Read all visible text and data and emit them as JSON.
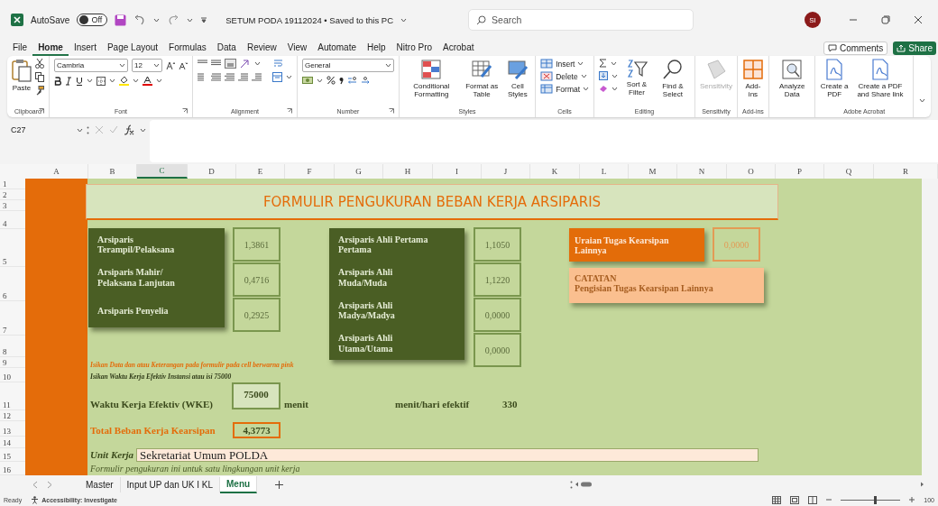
{
  "title_bar": {
    "autosave_label": "AutoSave",
    "autosave": {
      "label": "Off",
      "on": false
    },
    "document_title": "SETUM PODA 19112024 • Saved to this PC",
    "search": {
      "placeholder": "Search"
    },
    "avatar": "SI"
  },
  "menu_tabs": [
    {
      "label": "File",
      "selected": false
    },
    {
      "label": "Home",
      "selected": true
    },
    {
      "label": "Insert",
      "selected": false
    },
    {
      "label": "Page Layout",
      "selected": false
    },
    {
      "label": "Formulas",
      "selected": false
    },
    {
      "label": "Data",
      "selected": false
    },
    {
      "label": "Review",
      "selected": false
    },
    {
      "label": "View",
      "selected": false
    },
    {
      "label": "Automate",
      "selected": false
    },
    {
      "label": "Help",
      "selected": false
    },
    {
      "label": "Nitro Pro",
      "selected": false
    },
    {
      "label": "Acrobat",
      "selected": false
    }
  ],
  "actions": {
    "comments": "Comments",
    "share": "Share"
  },
  "ribbon": [
    {
      "kind": "clipboard",
      "label": "Clipboard",
      "buttons": [
        {
          "label": "Paste",
          "kind": "paste",
          "disabled": false
        }
      ]
    },
    {
      "kind": "font",
      "label": "Font",
      "font": "Cambria",
      "size": "12"
    },
    {
      "kind": "alignment",
      "label": "Alignment"
    },
    {
      "kind": "number",
      "label": "Number",
      "format": "General"
    },
    {
      "kind": "large",
      "label": "Styles",
      "buttons": [
        {
          "label": "Conditional Formatting",
          "kind": "conditional",
          "disabled": false
        },
        {
          "label": "Format as Table",
          "kind": "table",
          "disabled": false
        },
        {
          "label": "Cell Styles",
          "kind": "styles",
          "disabled": false
        }
      ]
    },
    {
      "kind": "cells",
      "label": "Cells",
      "buttons": [
        {
          "label": "Insert",
          "kind": "insert",
          "disabled": false
        },
        {
          "label": "Delete",
          "kind": "delete",
          "disabled": false
        },
        {
          "label": "Format",
          "kind": "format",
          "disabled": false
        }
      ]
    },
    {
      "kind": "editing",
      "label": "Editing",
      "buttons": [
        {
          "label": "Sort & Filter",
          "kind": "sort",
          "disabled": false
        },
        {
          "label": "Find & Select",
          "kind": "find",
          "disabled": false
        }
      ]
    },
    {
      "kind": "large",
      "label": "Sensitivity",
      "buttons": [
        {
          "label": "Sensitivity",
          "kind": "sensitivity",
          "disabled": true
        }
      ]
    },
    {
      "kind": "large",
      "label": "Add-ins",
      "buttons": [
        {
          "label": "Add-ins",
          "kind": "addins",
          "disabled": false
        }
      ]
    },
    {
      "kind": "large",
      "buttons": [
        {
          "label": "Analyze Data",
          "kind": "analyze",
          "disabled": false
        }
      ]
    },
    {
      "kind": "large",
      "label": "Adobe Acrobat",
      "buttons": [
        {
          "label": "Create a PDF",
          "kind": "pdf",
          "disabled": false
        },
        {
          "label": "Create a PDF and Share link",
          "kind": "pdf",
          "disabled": false
        }
      ]
    }
  ],
  "formula_bar": {
    "name_box": "C27"
  },
  "columns": [
    {
      "label": "A",
      "selected": false
    },
    {
      "label": "B",
      "selected": false
    },
    {
      "label": "C",
      "selected": true
    },
    {
      "label": "D",
      "selected": false
    },
    {
      "label": "E",
      "selected": false
    },
    {
      "label": "F",
      "selected": false
    },
    {
      "label": "G",
      "selected": false
    },
    {
      "label": "H",
      "selected": false
    },
    {
      "label": "I",
      "selected": false
    },
    {
      "label": "J",
      "selected": false
    },
    {
      "label": "K",
      "selected": false
    },
    {
      "label": "L",
      "selected": false
    },
    {
      "label": "M",
      "selected": false
    },
    {
      "label": "N",
      "selected": false
    },
    {
      "label": "O",
      "selected": false
    },
    {
      "label": "P",
      "selected": false
    },
    {
      "label": "Q",
      "selected": false
    },
    {
      "label": "R",
      "selected": false
    }
  ],
  "rows": [
    "1",
    "2",
    "3",
    "4",
    "5",
    "6",
    "7",
    "8",
    "9",
    "10",
    "11",
    "12",
    "13",
    "14",
    "15",
    "16"
  ],
  "sheet": {
    "title": "FORMULIR PENGUKURAN BEBAN KERJA ARSIPARIS",
    "left_roles": [
      {
        "label": "Arsiparis Terampil/Pelaksana",
        "value": "1,3861"
      },
      {
        "label": "Arsiparis Mahir/ Pelaksana Lanjutan",
        "value": "0,4716"
      },
      {
        "label": "Arsiparis Penyelia",
        "value": "0,2925"
      }
    ],
    "right_roles": [
      {
        "label": "Arsiparis Ahli Pertama Pertama",
        "value": "1,1050"
      },
      {
        "label": "Arsiparis Ahli Muda/Muda",
        "value": "1,1220"
      },
      {
        "label": "Arsiparis Ahli Madya/Madya",
        "value": "0,0000"
      },
      {
        "label": "Arsiparis Ahli Utama/Utama",
        "value": "0,0000"
      }
    ],
    "other_task": {
      "label": "Uraian Tugas Kearsipan Lainnya",
      "value": "0,0000"
    },
    "note": {
      "heading": "CATATAN",
      "text": "Pengisian Tugas Kearsipan Lainnya"
    },
    "instruction": "Isikan Data dan atau Keterangan pada formulir pada cell berwarna pink",
    "hint": "Isikan Waktu Kerja Efektiv Instansi atau isi 75000",
    "wke": {
      "label": "Waktu Kerja Efektiv (WKE)",
      "value": "75000",
      "unit": "menit"
    },
    "per_day": {
      "label": "menit/hari efektif",
      "value": "330"
    },
    "total": {
      "label": "Total Beban Kerja Kearsipan",
      "value": "4,3773"
    },
    "unit_kerja": {
      "label": "Unit Kerja",
      "value": "Sekretariat Umum POLDA"
    },
    "footnote": "Formulir pengukuran ini untuk satu lingkungan unit kerja"
  },
  "sheet_tabs": [
    {
      "label": "Master",
      "selected": false
    },
    {
      "label": "Input UP dan UK I KL",
      "selected": false
    },
    {
      "label": "Menu",
      "selected": true
    }
  ],
  "status_bar": {
    "ready": "Ready",
    "accessibility": "Accessibility: Investigate",
    "zoom": {
      "level": 0.55,
      "label": "100"
    }
  }
}
